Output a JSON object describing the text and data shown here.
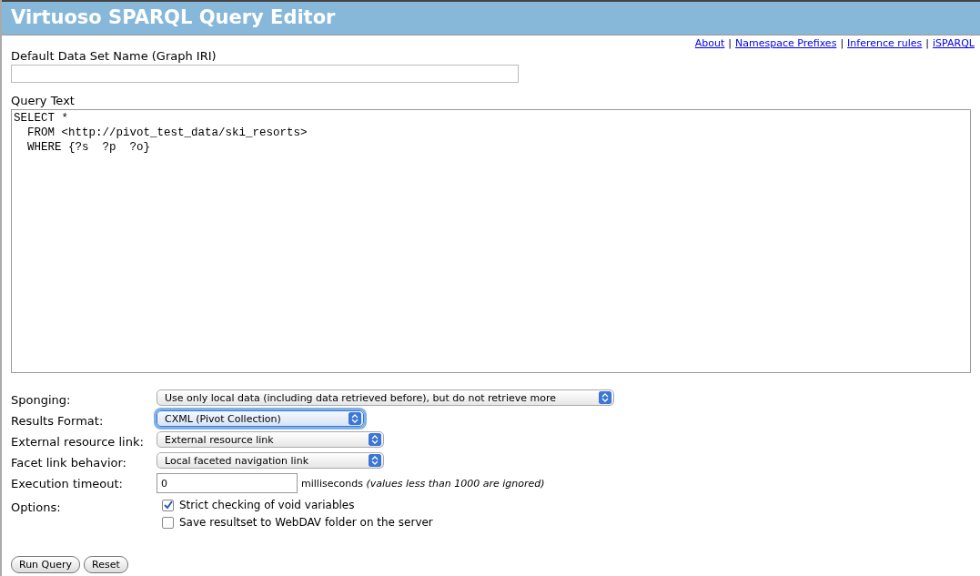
{
  "header": {
    "title": "Virtuoso SPARQL Query Editor"
  },
  "top_links": [
    {
      "kind": "link",
      "label": "About"
    },
    {
      "kind": "separator",
      "label": "|"
    },
    {
      "kind": "link",
      "label": "Namespace Prefixes"
    },
    {
      "kind": "separator",
      "label": "|"
    },
    {
      "kind": "link",
      "label": "Inference rules"
    },
    {
      "kind": "separator",
      "label": "|"
    },
    {
      "kind": "link",
      "label": "iSPARQL"
    }
  ],
  "default_graph": {
    "label": "Default Data Set Name (Graph IRI)"
  },
  "query": {
    "label": "Query Text",
    "value": "SELECT *\n  FROM <http://pivot_test_data/ski_resorts>\n  WHERE {?s  ?p  ?o}"
  },
  "settings": [
    {
      "kind": "select",
      "label": "Sponging:",
      "value": "Use only local data (including data retrieved before), but do not retrieve more",
      "focused": false
    },
    {
      "kind": "select",
      "label": "Results Format:",
      "value": "CXML (Pivot Collection)",
      "focused": true
    },
    {
      "kind": "select",
      "label": "External resource link:",
      "value": "External resource link",
      "focused": false
    },
    {
      "kind": "select",
      "label": "Facet link behavior:",
      "value": "Local faceted navigation link",
      "focused": false
    },
    {
      "kind": "input",
      "label": "Execution timeout:",
      "value": "0",
      "note": "milliseconds *(values less than 1000 are ignored)*"
    },
    {
      "kind": "checks",
      "label": "Options:",
      "options": [
        {
          "label": "Strict checking of void variables",
          "checked": true
        },
        {
          "label": "Save resultset to WebDAV folder on the server",
          "checked": false
        }
      ]
    }
  ],
  "buttons": [
    {
      "label": "Run Query"
    },
    {
      "label": "Reset"
    }
  ]
}
